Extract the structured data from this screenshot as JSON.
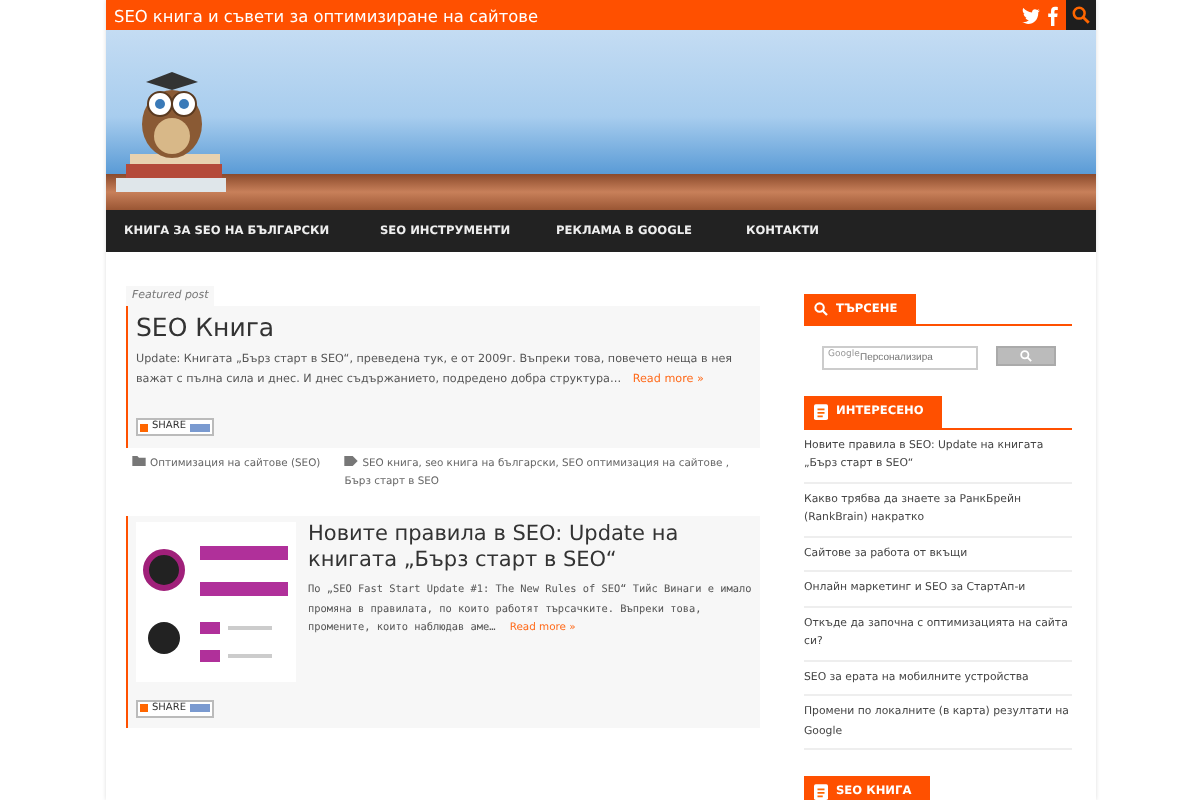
{
  "top_bar": {
    "site_title": "SEO книга и съвети за оптимизиране на сайтове"
  },
  "nav": {
    "items": [
      {
        "label": "КНИГА ЗА SEO НА БЪЛГАРСКИ"
      },
      {
        "label": "SEO ИНСТРУМЕНТИ"
      },
      {
        "label": "РЕКЛАМА В GOOGLE"
      },
      {
        "label": "КОНТАКТИ"
      }
    ]
  },
  "posts": [
    {
      "kind": "featured",
      "tag": "Featured post",
      "title": "SEO Книга",
      "excerpt": "Update: Книгата „Бърз старт в SEO“, преведена тук, е от 2009г. Въпреки това, повечето неща в нея важат с пълна сила и днес. И днес съдържанието, подредено добра структура…",
      "read_more": "Read more »",
      "share": "SHARE",
      "category": "Оптимизация на сайтове (SEO)",
      "tags": "SEO книга, seo книга на български, SEO оптимизация на сайтове , Бърз старт в SEO"
    },
    {
      "kind": "thumb",
      "title": "Новите правила в SEO: Update на книгата „Бърз старт в SEO“",
      "excerpt": "По „SEO Fast Start Update #1: The New Rules of SEO“ Тийс Винаги е имало промяна в правилата, по които работят търсачките. Въпреки това, промените, които наблюдав аме…",
      "read_more": "Read more »",
      "share": "SHARE"
    }
  ],
  "sidebar": {
    "widgets": [
      {
        "kind": "search",
        "title": "ТЪРСЕНЕ",
        "brand": "Google",
        "placeholder": "Персонализира"
      },
      {
        "kind": "list",
        "title": "ИНТЕРЕСЕНО",
        "items": [
          "Новите правила в SEO: Update на книгата „Бърз старт в SEO“",
          "Какво трябва да знаете за РанкБрейн (RankBrain) накратко",
          "Сайтове за работа от вкъщи",
          "Онлайн маркетинг и SEO за СтартАп-и",
          "Откъде да започна с оптимизацията на сайта си?",
          "SEO за ерата на мобилните устройства",
          "Промени по локалните (в карта) резултати на Google"
        ]
      },
      {
        "kind": "list",
        "title": "SEO КНИГА"
      }
    ]
  }
}
